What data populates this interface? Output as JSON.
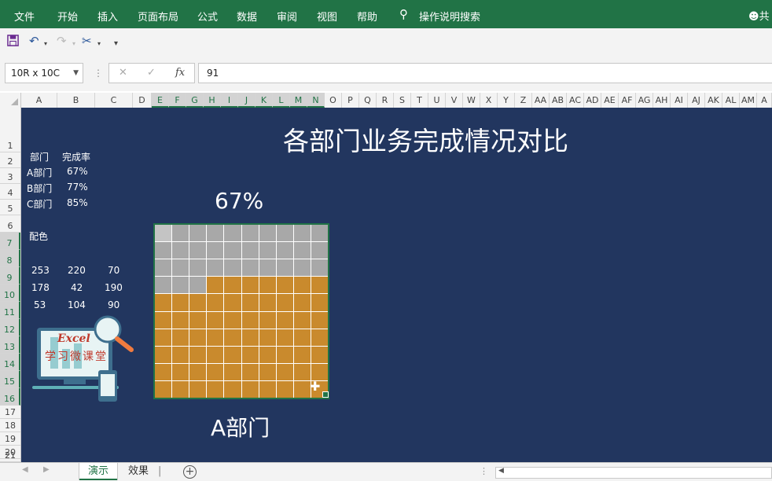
{
  "ribbon": {
    "tabs": [
      "文件",
      "开始",
      "插入",
      "页面布局",
      "公式",
      "数据",
      "审阅",
      "视图",
      "帮助"
    ],
    "search_label": "操作说明搜索",
    "share_label": "共"
  },
  "formula_bar": {
    "name_box": "10R x 10C",
    "fx_label": "fx",
    "value": "91"
  },
  "columns": [
    "A",
    "B",
    "C",
    "D",
    "E",
    "F",
    "G",
    "H",
    "I",
    "J",
    "K",
    "L",
    "M",
    "N",
    "O",
    "P",
    "Q",
    "R",
    "S",
    "T",
    "U",
    "V",
    "W",
    "X",
    "Y",
    "Z",
    "AA",
    "AB",
    "AC",
    "AD",
    "AE",
    "AF",
    "AG",
    "AH",
    "AI",
    "AJ",
    "AK",
    "AL",
    "AM",
    "A"
  ],
  "rows": [
    "1",
    "2",
    "3",
    "4",
    "5",
    "6",
    "7",
    "8",
    "9",
    "10",
    "11",
    "12",
    "13",
    "14",
    "15",
    "16",
    "17",
    "18",
    "19",
    "20",
    "21"
  ],
  "sheet": {
    "title": "各部门业务完成情况对比",
    "table_header": {
      "dept": "部门",
      "rate": "完成率"
    },
    "table_rows": [
      {
        "dept": "A部门",
        "rate": "67%"
      },
      {
        "dept": "B部门",
        "rate": "77%"
      },
      {
        "dept": "C部门",
        "rate": "85%"
      }
    ],
    "palette_label": "配色",
    "palette": [
      [
        "253",
        "220",
        "70"
      ],
      [
        "178",
        "42",
        "190"
      ],
      [
        "53",
        "104",
        "90"
      ]
    ],
    "chart_percent": "67%",
    "chart_dept": "A部门",
    "logo_text": "Excel",
    "logo_subtitle": "学习微课堂"
  },
  "chart_data": {
    "type": "heatmap",
    "grid": [
      10,
      10
    ],
    "filled_cells": 67,
    "total_cells": 100,
    "fill_color": "#c98a2d",
    "empty_color": "#a8a8a8"
  },
  "sheet_tabs": [
    "演示",
    "效果"
  ],
  "colors": {
    "excel_green": "#217346",
    "sheet_bg": "#22365f"
  }
}
